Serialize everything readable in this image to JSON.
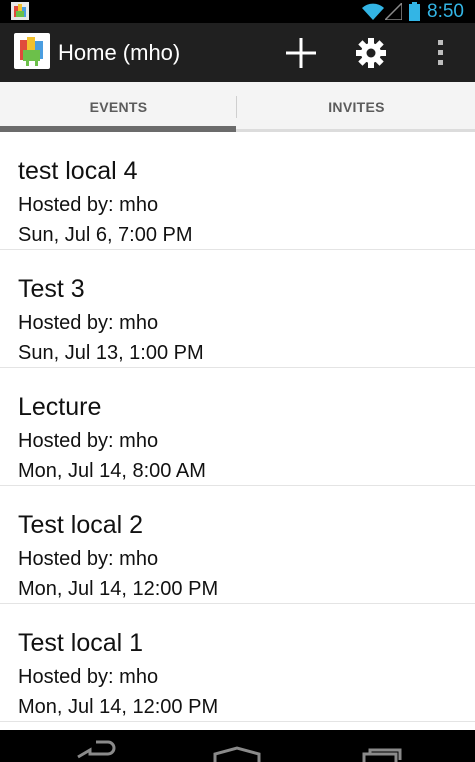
{
  "status_bar": {
    "time": "8:50",
    "accent_color": "#33b5e5",
    "icons": [
      "app-notification-icon",
      "wifi-icon",
      "signal-icon",
      "battery-icon"
    ]
  },
  "action_bar": {
    "title": "Home (mho)",
    "actions": [
      "add-icon",
      "settings-gear-icon",
      "overflow-menu-icon"
    ],
    "background_color": "#202020"
  },
  "tabs": [
    {
      "label": "EVENTS",
      "selected": true
    },
    {
      "label": "INVITES",
      "selected": false
    }
  ],
  "events": [
    {
      "title": "test local 4",
      "host": "Hosted by: mho",
      "time": "Sun, Jul 6, 7:00 PM"
    },
    {
      "title": "Test 3",
      "host": "Hosted by: mho",
      "time": "Sun, Jul 13, 1:00 PM"
    },
    {
      "title": "Lecture",
      "host": "Hosted by: mho",
      "time": "Mon, Jul 14, 8:00 AM"
    },
    {
      "title": "Test local 2",
      "host": "Hosted by: mho",
      "time": "Mon, Jul 14, 12:00 PM"
    },
    {
      "title": "Test local 1",
      "host": "Hosted by: mho",
      "time": "Mon, Jul 14, 12:00 PM"
    }
  ],
  "navigation_bar": {
    "buttons": [
      "back-icon",
      "home-icon",
      "recent-apps-icon"
    ]
  }
}
